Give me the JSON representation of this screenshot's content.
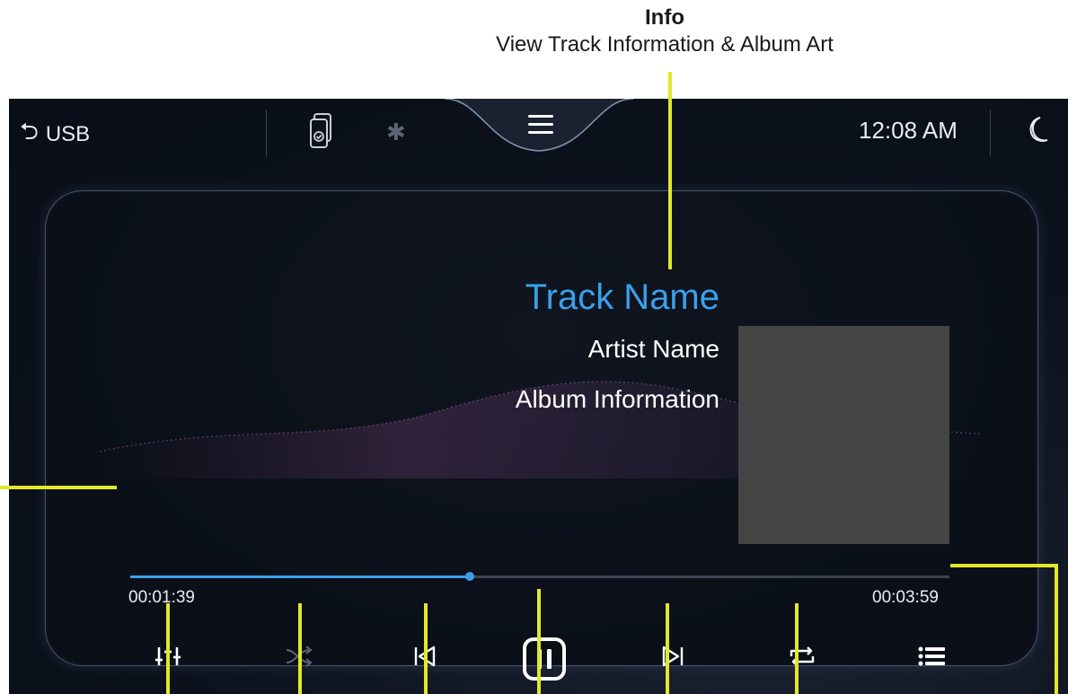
{
  "callout": {
    "title": "Info",
    "subtitle": "View Track Information & Album Art"
  },
  "statusbar": {
    "source_label": "USB",
    "time": "12:08 AM"
  },
  "track": {
    "name": "Track Name",
    "artist": "Artist Name",
    "album": "Album Information"
  },
  "progress": {
    "elapsed": "00:01:39",
    "total": "00:03:59",
    "fraction": 0.414
  },
  "controls": {
    "equalizer": "equalizer-icon",
    "shuffle": "shuffle-icon",
    "previous": "previous-track-icon",
    "pause": "pause-icon",
    "next": "next-track-icon",
    "repeat": "repeat-icon",
    "playlist": "playlist-icon"
  },
  "colors": {
    "accent": "#3aa0ec",
    "callout_line": "#e2e72a",
    "album_art_placeholder": "#444444"
  }
}
